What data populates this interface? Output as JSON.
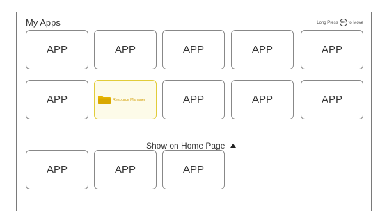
{
  "header": {
    "title": "My Apps",
    "hint_prefix": "Long Press",
    "hint_key": "OK",
    "hint_suffix": "to Move"
  },
  "grid_row1": [
    "APP",
    "APP",
    "APP",
    "APP",
    "APP"
  ],
  "grid_row2": {
    "app1": "APP",
    "selected_label": "Resource Manager",
    "app3": "APP",
    "app4": "APP",
    "app5": "APP"
  },
  "divider": {
    "label": "Show on Home Page"
  },
  "home_apps": [
    "APP",
    "APP",
    "APP"
  ],
  "colors": {
    "selected_border": "#e1cc3a",
    "selected_text": "#d4a20b",
    "folder": "#e6b400"
  },
  "icons": {
    "hint_key": "ok-button-icon",
    "folder": "folder-icon",
    "toggle": "triangle-up-icon"
  }
}
